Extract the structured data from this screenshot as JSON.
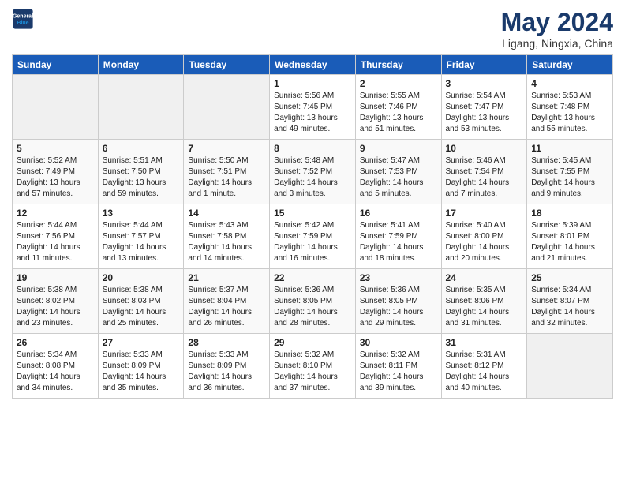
{
  "header": {
    "logo_line1": "General",
    "logo_line2": "Blue",
    "month_title": "May 2024",
    "location": "Ligang, Ningxia, China"
  },
  "days_of_week": [
    "Sunday",
    "Monday",
    "Tuesday",
    "Wednesday",
    "Thursday",
    "Friday",
    "Saturday"
  ],
  "weeks": [
    [
      {
        "day": "",
        "info": ""
      },
      {
        "day": "",
        "info": ""
      },
      {
        "day": "",
        "info": ""
      },
      {
        "day": "1",
        "info": "Sunrise: 5:56 AM\nSunset: 7:45 PM\nDaylight: 13 hours\nand 49 minutes."
      },
      {
        "day": "2",
        "info": "Sunrise: 5:55 AM\nSunset: 7:46 PM\nDaylight: 13 hours\nand 51 minutes."
      },
      {
        "day": "3",
        "info": "Sunrise: 5:54 AM\nSunset: 7:47 PM\nDaylight: 13 hours\nand 53 minutes."
      },
      {
        "day": "4",
        "info": "Sunrise: 5:53 AM\nSunset: 7:48 PM\nDaylight: 13 hours\nand 55 minutes."
      }
    ],
    [
      {
        "day": "5",
        "info": "Sunrise: 5:52 AM\nSunset: 7:49 PM\nDaylight: 13 hours\nand 57 minutes."
      },
      {
        "day": "6",
        "info": "Sunrise: 5:51 AM\nSunset: 7:50 PM\nDaylight: 13 hours\nand 59 minutes."
      },
      {
        "day": "7",
        "info": "Sunrise: 5:50 AM\nSunset: 7:51 PM\nDaylight: 14 hours\nand 1 minute."
      },
      {
        "day": "8",
        "info": "Sunrise: 5:48 AM\nSunset: 7:52 PM\nDaylight: 14 hours\nand 3 minutes."
      },
      {
        "day": "9",
        "info": "Sunrise: 5:47 AM\nSunset: 7:53 PM\nDaylight: 14 hours\nand 5 minutes."
      },
      {
        "day": "10",
        "info": "Sunrise: 5:46 AM\nSunset: 7:54 PM\nDaylight: 14 hours\nand 7 minutes."
      },
      {
        "day": "11",
        "info": "Sunrise: 5:45 AM\nSunset: 7:55 PM\nDaylight: 14 hours\nand 9 minutes."
      }
    ],
    [
      {
        "day": "12",
        "info": "Sunrise: 5:44 AM\nSunset: 7:56 PM\nDaylight: 14 hours\nand 11 minutes."
      },
      {
        "day": "13",
        "info": "Sunrise: 5:44 AM\nSunset: 7:57 PM\nDaylight: 14 hours\nand 13 minutes."
      },
      {
        "day": "14",
        "info": "Sunrise: 5:43 AM\nSunset: 7:58 PM\nDaylight: 14 hours\nand 14 minutes."
      },
      {
        "day": "15",
        "info": "Sunrise: 5:42 AM\nSunset: 7:59 PM\nDaylight: 14 hours\nand 16 minutes."
      },
      {
        "day": "16",
        "info": "Sunrise: 5:41 AM\nSunset: 7:59 PM\nDaylight: 14 hours\nand 18 minutes."
      },
      {
        "day": "17",
        "info": "Sunrise: 5:40 AM\nSunset: 8:00 PM\nDaylight: 14 hours\nand 20 minutes."
      },
      {
        "day": "18",
        "info": "Sunrise: 5:39 AM\nSunset: 8:01 PM\nDaylight: 14 hours\nand 21 minutes."
      }
    ],
    [
      {
        "day": "19",
        "info": "Sunrise: 5:38 AM\nSunset: 8:02 PM\nDaylight: 14 hours\nand 23 minutes."
      },
      {
        "day": "20",
        "info": "Sunrise: 5:38 AM\nSunset: 8:03 PM\nDaylight: 14 hours\nand 25 minutes."
      },
      {
        "day": "21",
        "info": "Sunrise: 5:37 AM\nSunset: 8:04 PM\nDaylight: 14 hours\nand 26 minutes."
      },
      {
        "day": "22",
        "info": "Sunrise: 5:36 AM\nSunset: 8:05 PM\nDaylight: 14 hours\nand 28 minutes."
      },
      {
        "day": "23",
        "info": "Sunrise: 5:36 AM\nSunset: 8:05 PM\nDaylight: 14 hours\nand 29 minutes."
      },
      {
        "day": "24",
        "info": "Sunrise: 5:35 AM\nSunset: 8:06 PM\nDaylight: 14 hours\nand 31 minutes."
      },
      {
        "day": "25",
        "info": "Sunrise: 5:34 AM\nSunset: 8:07 PM\nDaylight: 14 hours\nand 32 minutes."
      }
    ],
    [
      {
        "day": "26",
        "info": "Sunrise: 5:34 AM\nSunset: 8:08 PM\nDaylight: 14 hours\nand 34 minutes."
      },
      {
        "day": "27",
        "info": "Sunrise: 5:33 AM\nSunset: 8:09 PM\nDaylight: 14 hours\nand 35 minutes."
      },
      {
        "day": "28",
        "info": "Sunrise: 5:33 AM\nSunset: 8:09 PM\nDaylight: 14 hours\nand 36 minutes."
      },
      {
        "day": "29",
        "info": "Sunrise: 5:32 AM\nSunset: 8:10 PM\nDaylight: 14 hours\nand 37 minutes."
      },
      {
        "day": "30",
        "info": "Sunrise: 5:32 AM\nSunset: 8:11 PM\nDaylight: 14 hours\nand 39 minutes."
      },
      {
        "day": "31",
        "info": "Sunrise: 5:31 AM\nSunset: 8:12 PM\nDaylight: 14 hours\nand 40 minutes."
      },
      {
        "day": "",
        "info": ""
      }
    ]
  ]
}
